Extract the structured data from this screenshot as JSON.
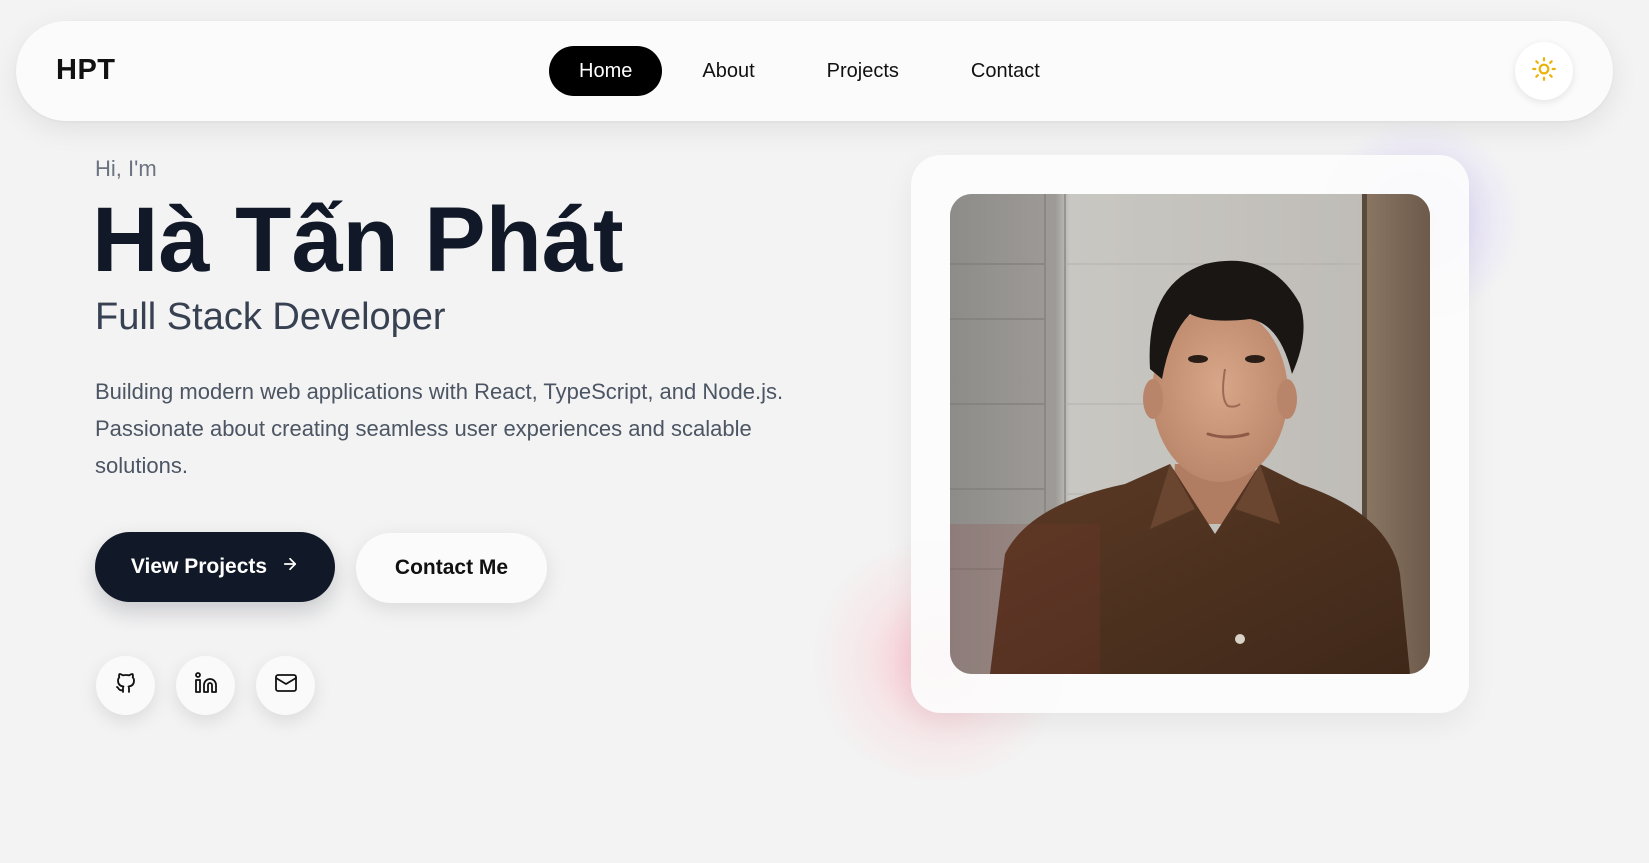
{
  "nav": {
    "brand": "HPT",
    "links": [
      {
        "label": "Home",
        "active": true
      },
      {
        "label": "About",
        "active": false
      },
      {
        "label": "Projects",
        "active": false
      },
      {
        "label": "Contact",
        "active": false
      }
    ],
    "theme_icon": "sun-icon"
  },
  "hero": {
    "greeting": "Hi, I'm",
    "name": "Hà Tấn Phát",
    "role": "Full Stack Developer",
    "description": "Building modern web applications with React, TypeScript, and Node.js. Passionate about creating seamless user experiences and scalable solutions.",
    "primary_button": {
      "label": "View Projects",
      "icon": "arrow-right-icon"
    },
    "secondary_button": {
      "label": "Contact Me"
    },
    "socials": [
      {
        "icon": "github-icon"
      },
      {
        "icon": "linkedin-icon"
      },
      {
        "icon": "mail-icon"
      }
    ]
  },
  "profile": {
    "photo": "profile-photo"
  },
  "colors": {
    "background": "#f3f3f3",
    "primary": "#111827",
    "accent_sun": "#eab308",
    "glow_purple": "#b4a0ff",
    "glow_pink": "#ff96aa"
  }
}
